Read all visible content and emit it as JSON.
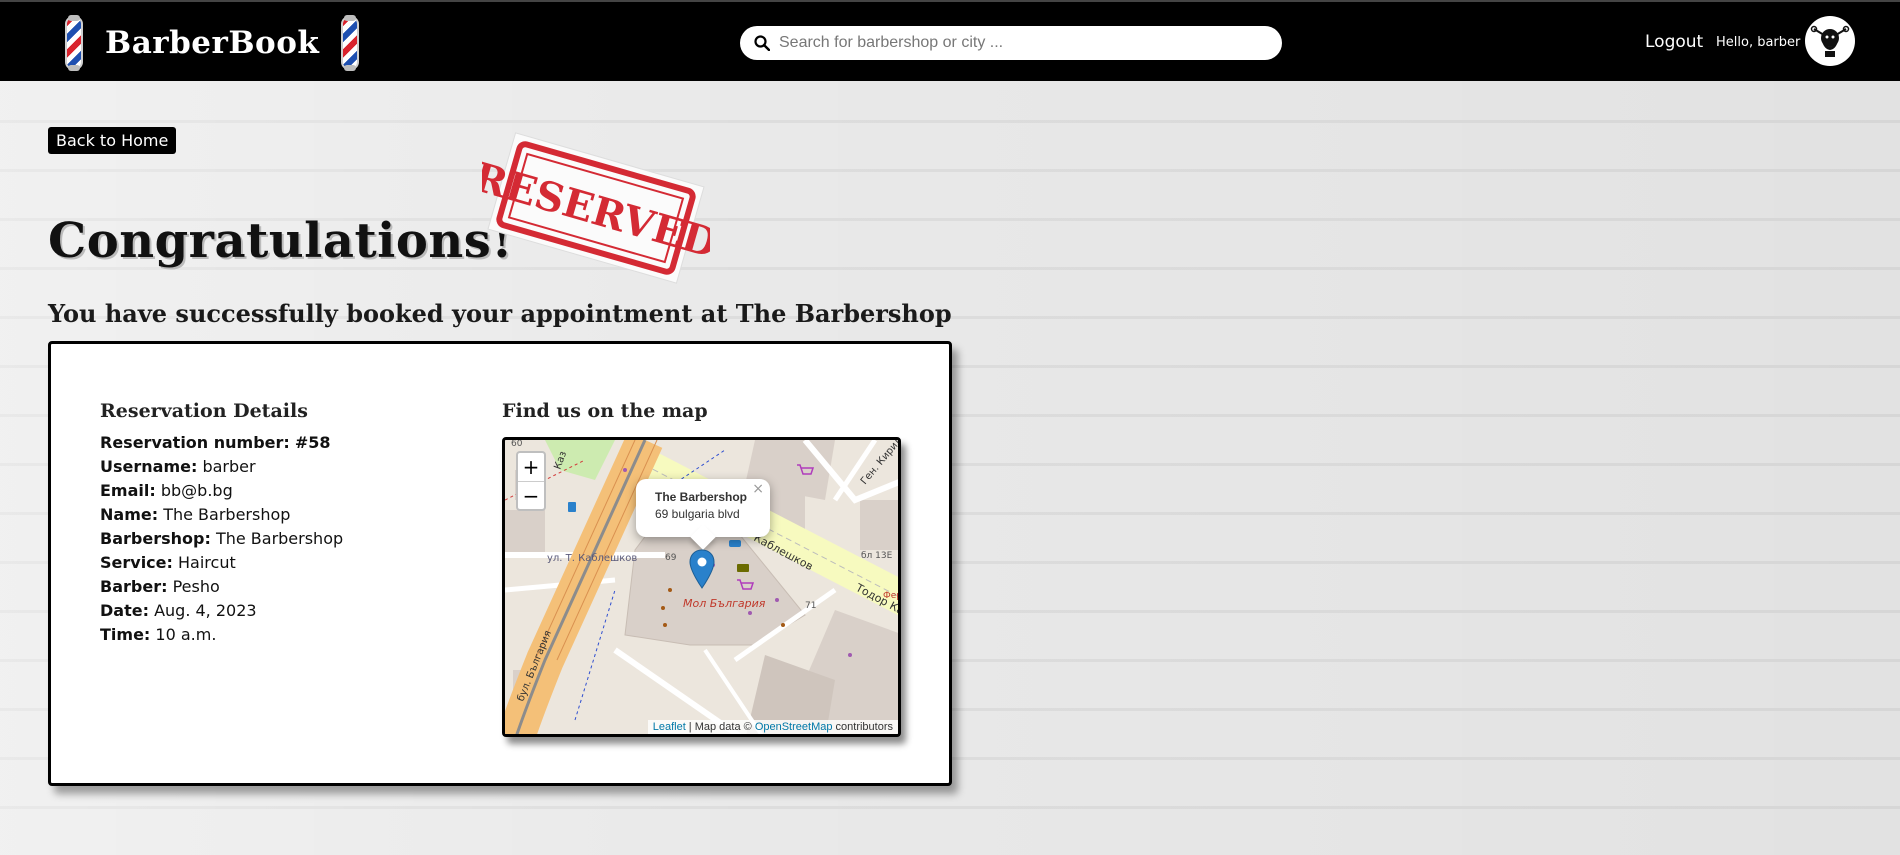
{
  "header": {
    "brand": "BarberBook",
    "search_placeholder": "Search for barbershop or city ...",
    "logout": "Logout",
    "greeting": "Hello, barber"
  },
  "page": {
    "back_button": "Back to Home",
    "heading": "Congratulations!",
    "stamp_text": "RESERVED",
    "subtitle": "You have successfully booked your appointment at The Barbershop"
  },
  "details": {
    "title": "Reservation Details",
    "rows": [
      {
        "label": "Reservation number:",
        "value": "#58"
      },
      {
        "label": "Username:",
        "value": "barber"
      },
      {
        "label": "Email:",
        "value": "bb@b.bg"
      },
      {
        "label": "Name:",
        "value": "The Barbershop"
      },
      {
        "label": "Barbershop:",
        "value": "The Barbershop"
      },
      {
        "label": "Service:",
        "value": "Haircut"
      },
      {
        "label": "Barber:",
        "value": "Pesho"
      },
      {
        "label": "Date:",
        "value": "Aug. 4, 2023"
      },
      {
        "label": "Time:",
        "value": "10 a.m."
      }
    ]
  },
  "map": {
    "title": "Find us on the map",
    "zoom_in": "+",
    "zoom_out": "−",
    "popup_title": "The Barbershop",
    "popup_address": "69 bulgaria blvd",
    "popup_close": "×",
    "labels": {
      "street1": "ул. Т. Каблешков",
      "street2": "бул. България",
      "street3": "Каблешков",
      "street4": "Тодор Ка",
      "mall": "Мол България",
      "building": "бл 13Е",
      "num1": "69",
      "num2": "71",
      "num3": "60",
      "street5": "Ген. Кирил",
      "street6": "Каз",
      "short": "Фер"
    },
    "attribution": {
      "leaflet": "Leaflet",
      "sep": " | Map data © ",
      "osm": "OpenStreetMap",
      "tail": " contributors"
    }
  },
  "colors": {
    "header_bg": "#000000",
    "marker": "#2a81cb",
    "stamp_red": "#d42a34"
  }
}
